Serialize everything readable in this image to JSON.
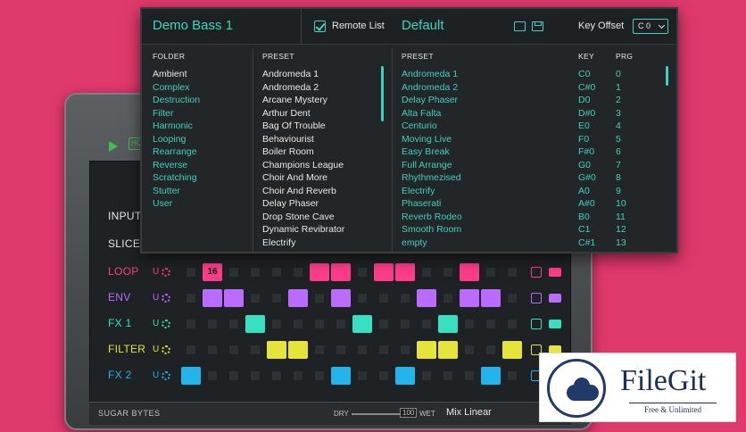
{
  "browser": {
    "preset_title": "Demo Bass 1",
    "remote_list_label": "Remote List",
    "remote_list_checked": true,
    "remote_title": "Default",
    "key_offset_label": "Key Offset",
    "key_offset_value": "C 0",
    "folder_header": "FOLDER",
    "preset_header": "PRESET",
    "remote_preset_header": "PRESET",
    "key_header": "KEY",
    "prg_header": "PRG",
    "folders": [
      "Ambient",
      "Complex",
      "Destruction",
      "Filter",
      "Harmonic",
      "Looping",
      "Rearrange",
      "Reverse",
      "Scratching",
      "Stutter",
      "User"
    ],
    "selected_folder": "Ambient",
    "presets": [
      "Andromeda 1",
      "Andromeda 2",
      "Arcane Mystery",
      "Arthur Dent",
      "Bag Of Trouble",
      "Behaviourist",
      "Boiler Room",
      "Champions League",
      "Choir And More",
      "Choir And Reverb",
      "Delay Phaser",
      "Drop Stone Cave",
      "Dynamic Revibrator",
      "Electrify"
    ],
    "remote_list": [
      {
        "preset": "Andromeda 1",
        "key": "C0",
        "prg": "0"
      },
      {
        "preset": "Andromeda 2",
        "key": "C#0",
        "prg": "1"
      },
      {
        "preset": "Delay Phaser",
        "key": "D0",
        "prg": "2"
      },
      {
        "preset": "Alta Falta",
        "key": "D#0",
        "prg": "3"
      },
      {
        "preset": "Centurio",
        "key": "E0",
        "prg": "4"
      },
      {
        "preset": "Moving Live",
        "key": "F0",
        "prg": "5"
      },
      {
        "preset": "Easy Break",
        "key": "F#0",
        "prg": "6"
      },
      {
        "preset": "Full Arrange",
        "key": "G0",
        "prg": "7"
      },
      {
        "preset": "Rhythmezised",
        "key": "G#0",
        "prg": "8"
      },
      {
        "preset": "Electrify",
        "key": "A0",
        "prg": "9"
      },
      {
        "preset": "Phaserati",
        "key": "A#0",
        "prg": "10"
      },
      {
        "preset": "Reverb Rodeo",
        "key": "B0",
        "prg": "11"
      },
      {
        "preset": "Smooth Room",
        "key": "C1",
        "prg": "12"
      },
      {
        "preset": "empty",
        "key": "C#1",
        "prg": "13"
      }
    ]
  },
  "plugin": {
    "play_badge": "HQ",
    "rows": [
      {
        "label": "INPUT",
        "color": "#e8e8e8"
      },
      {
        "label": "SLICE",
        "color": "#e8e8e8"
      },
      {
        "label": "LOOP",
        "color": "#ff3d8b"
      },
      {
        "label": "ENV",
        "color": "#b96cff"
      },
      {
        "label": "FX 1",
        "color": "#36e0c0"
      },
      {
        "label": "FILTER",
        "color": "#e6e43a"
      },
      {
        "label": "FX 2",
        "color": "#22b4ea"
      }
    ],
    "u_label": "U",
    "loop_value": "16",
    "brand": "SUGAR BYTES",
    "dry_label": "DRY",
    "mix_value": "100",
    "wet_label": "WET",
    "mix_mode": "Mix Linear"
  },
  "watermark": {
    "name": "FileGit",
    "tagline": "Free & Unlimited"
  },
  "colors": {
    "accent": "#3fd0bf",
    "background": "#e0396c",
    "loop": "#ff3d8b",
    "env": "#b96cff",
    "fx1": "#36e0c0",
    "filter": "#e6e43a",
    "fx2": "#22b4ea"
  }
}
